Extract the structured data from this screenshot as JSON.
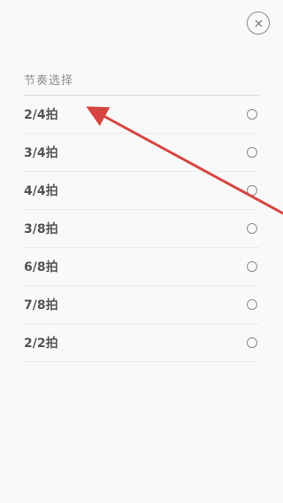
{
  "header": {
    "close_icon": "close-circle-icon"
  },
  "section": {
    "title": "节奏选择"
  },
  "options": [
    {
      "label": "2/4拍",
      "selected": false
    },
    {
      "label": "3/4拍",
      "selected": false
    },
    {
      "label": "4/4拍",
      "selected": false
    },
    {
      "label": "3/8拍",
      "selected": false
    },
    {
      "label": "6/8拍",
      "selected": false
    },
    {
      "label": "7/8拍",
      "selected": false
    },
    {
      "label": "2/2拍",
      "selected": false
    }
  ],
  "annotation": {
    "color": "#d64541",
    "icon": "red-arrow-icon"
  }
}
